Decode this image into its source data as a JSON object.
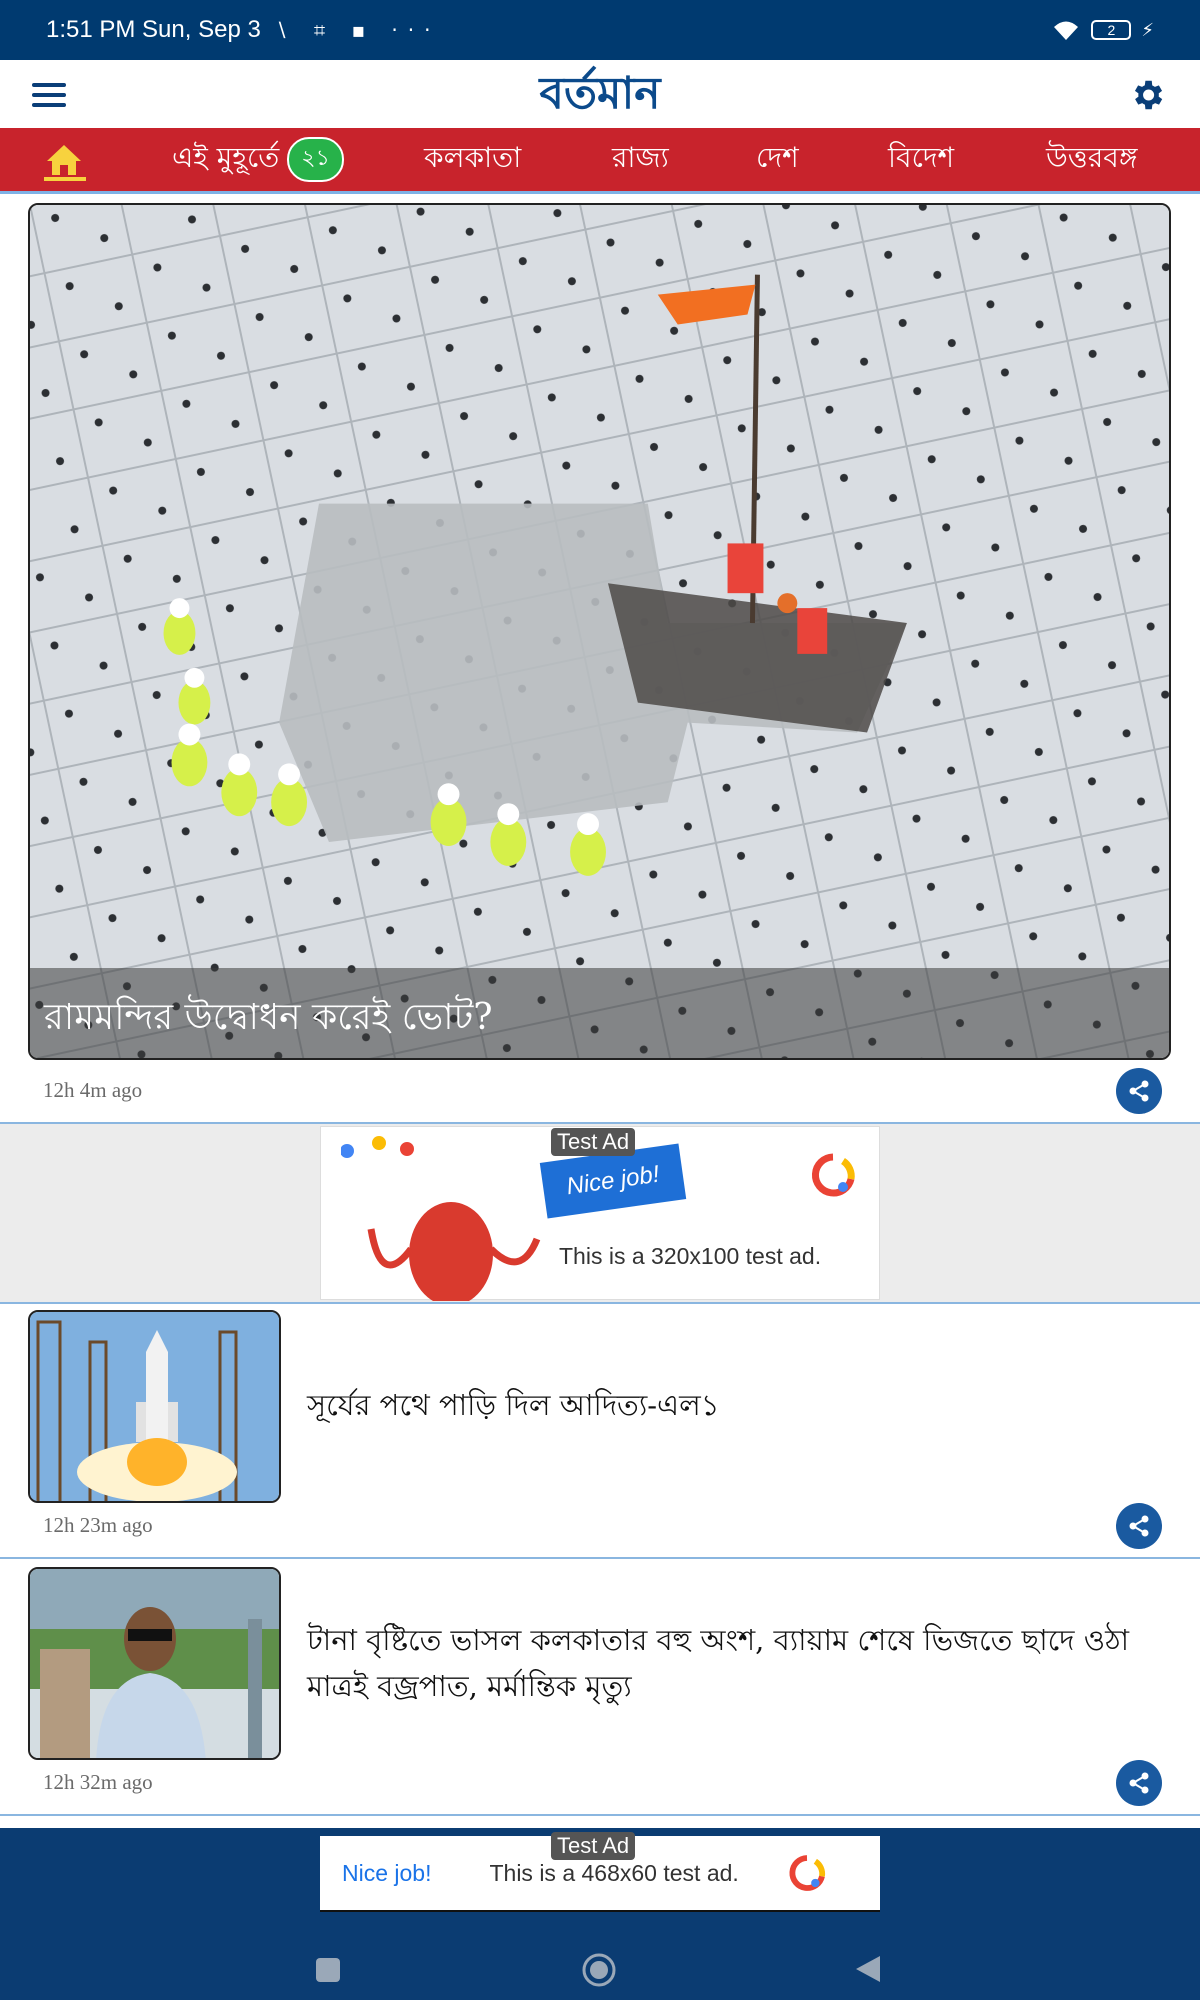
{
  "status_bar": {
    "time": "1:51 PM Sun, Sep 3",
    "left_icons": "∖ ⌗ ▪ ···",
    "battery": "2"
  },
  "app_bar": {
    "logo": "বর্তমান",
    "menu_icon": "hamburger-menu-icon",
    "settings_icon": "gear-icon"
  },
  "categories": {
    "home_icon": "home-icon",
    "tabs": [
      {
        "label": "এই মুহূর্তে",
        "badge": "২১"
      },
      {
        "label": "কলকাতা"
      },
      {
        "label": "রাজ্য"
      },
      {
        "label": "দেশ"
      },
      {
        "label": "বিদেশ"
      },
      {
        "label": "উত্তরবঙ্গ"
      }
    ]
  },
  "hero": {
    "title": "রামমন্দির উদ্বোধন করেই ভোট?",
    "time": "12h 4m ago"
  },
  "ad_top": {
    "label": "Test Ad",
    "banner": "Nice job!",
    "text": "This is a 320x100 test ad."
  },
  "articles": [
    {
      "title": "সূর্যের পথে পাড়ি দিল আদিত্য-এল১",
      "time": "12h 23m ago"
    },
    {
      "title": "টানা বৃষ্টিতে ভাসল কলকাতার বহু অংশ, ব্যায়াম শেষে ভিজতে ছাদে ওঠা মাত্রই বজ্রপাত, মর্মান্তিক মৃত্যু",
      "time": "12h 32m ago"
    }
  ],
  "ad_bottom": {
    "label": "Test Ad",
    "nice": "Nice job!",
    "text": "This is a 468x60 test ad."
  },
  "colors": {
    "status_bar": "#003a70",
    "nav_red": "#c8232c",
    "logo_blue": "#0b4a8b",
    "share_blue": "#1a5aa0",
    "badge_green": "#27b24a"
  }
}
